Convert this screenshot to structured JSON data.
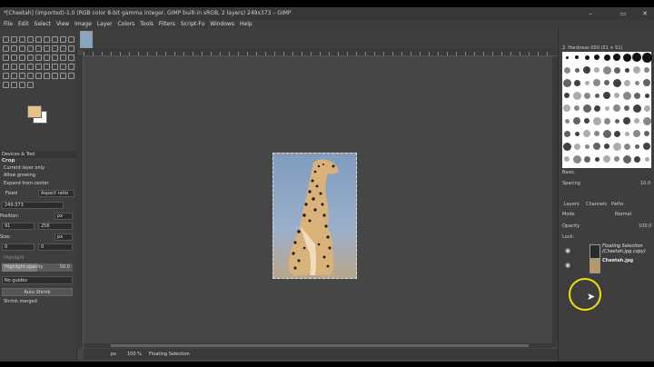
{
  "window": {
    "title": "*[Cheetah] (imported)-1.0 (RGB color 8-bit gamma integer, GIMP built-in sRGB, 2 layers) 249x373 – GIMP",
    "controls": [
      "–",
      "▭",
      "✕"
    ]
  },
  "menu": [
    "File",
    "Edit",
    "Select",
    "View",
    "Image",
    "Layer",
    "Colors",
    "Tools",
    "Filters",
    "Script-Fu",
    "Windows",
    "Help"
  ],
  "tool_options": {
    "tabs_label": "Devices & Tool",
    "title": "Crop",
    "current_layer_only": "Current layer only",
    "allow_growing": "Allow growing",
    "expand_from_center": "Expand from center",
    "fixed_label": "Fixed",
    "aspect_label": "Aspect ratio",
    "ratio_value": "249:373",
    "position_label": "Position:",
    "pos_x": "91",
    "pos_y": "256",
    "unit": "px",
    "size_label": "Size:",
    "size_w": "0",
    "size_h": "0",
    "highlight_label": "Highlight",
    "highlight_opacity_label": "Highlight opacity",
    "highlight_opacity_value": "50.0",
    "highlight_opacity_fraction": 0.5,
    "guides_value": "No guides",
    "auto_shrink": "Auto Shrink",
    "shrink_merged": "Shrink merged"
  },
  "colors": {
    "foreground": "#e8c08a",
    "background": "#ffffff",
    "accent_cursor": "#f0e010"
  },
  "status": {
    "unit": "px",
    "zoom": "100 %",
    "message": "Floating Selection"
  },
  "brushes": {
    "header": "2. Hardness 050 (51 × 51)",
    "preset": "Basic.",
    "spacing_label": "Spacing",
    "spacing_value": "10.0"
  },
  "layers": {
    "tabs": [
      "Layers",
      "Channels",
      "Paths"
    ],
    "mode_label": "Mode",
    "mode_value": "Normal",
    "opacity_label": "Opacity",
    "opacity_value": "100.0",
    "lock_label": "Lock:",
    "items": [
      {
        "name": "Floating Selection\n(Cheetah.jpg copy)",
        "visible": true
      },
      {
        "name": "Cheetah.jpg",
        "visible": true
      }
    ]
  }
}
